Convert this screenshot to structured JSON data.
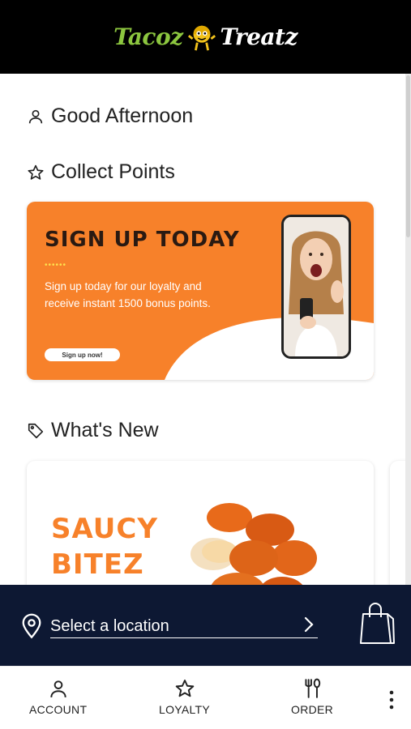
{
  "header": {
    "logo_word1": "Tacoz",
    "logo_word2": "Treatz",
    "logo_icon": "taco-mascot-icon"
  },
  "greeting": {
    "text": "Good Afternoon",
    "icon": "user-icon"
  },
  "collect": {
    "title": "Collect Points",
    "icon": "star-icon"
  },
  "promo": {
    "title": "SIGN UP TODAY",
    "dots": "••••••",
    "body": "Sign up today for our loyalty and receive instant 1500 bonus points.",
    "button": "Sign up now!"
  },
  "whats_new": {
    "title": "What's New",
    "icon": "tag-icon",
    "card_line1": "SAUCY",
    "card_line2": "BITEZ"
  },
  "location": {
    "label": "Select a location",
    "pin_icon": "location-pin-icon",
    "chevron_icon": "chevron-right-icon",
    "bag_icon": "shopping-bag-icon"
  },
  "nav": {
    "account": "ACCOUNT",
    "loyalty": "LOYALTY",
    "order": "ORDER",
    "more_icon": "more-vertical-icon"
  },
  "colors": {
    "brand_orange": "#f7812a",
    "brand_green": "#8cc63f",
    "navy": "#0d1833"
  }
}
